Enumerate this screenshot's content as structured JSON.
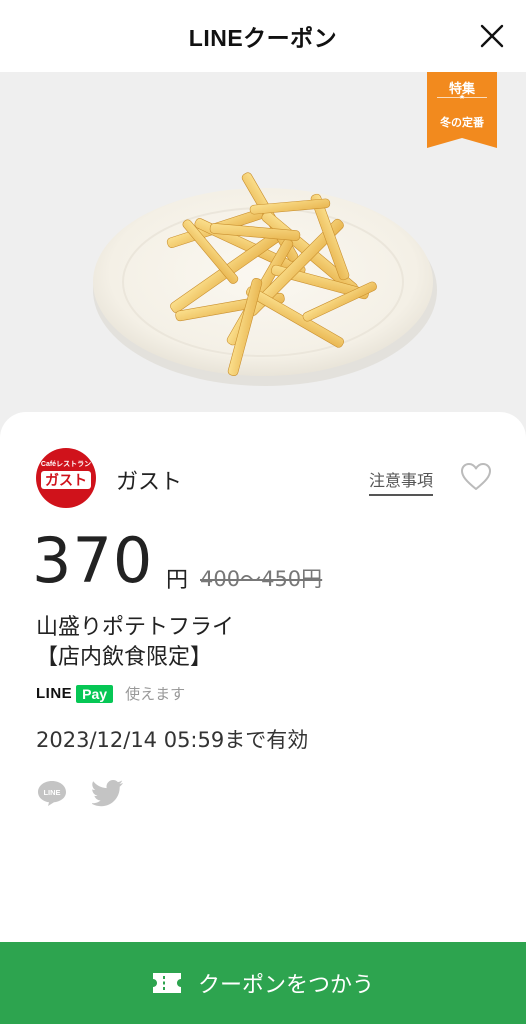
{
  "header": {
    "title": "LINEクーポン",
    "close_icon": "close-icon"
  },
  "hero": {
    "image": "french-fries-plate",
    "ribbon": {
      "line1": "特集",
      "line2": "冬の定番",
      "color": "#f28a1e"
    }
  },
  "coupon": {
    "brand": {
      "logo_text_top": "Caféレストラン",
      "logo_text_main": "ガスト",
      "logo_color": "#d0121b",
      "name": "ガスト"
    },
    "notes_link": "注意事項",
    "favorite_icon": "heart-icon",
    "price": "370",
    "price_unit": "円",
    "original_price": "400〜450円",
    "title_line1": "山盛りポテトフライ",
    "title_line2": "【店内飲食限定】",
    "linepay": {
      "line": "LINE",
      "pay": "Pay",
      "availability": "使えます",
      "color": "#06c755"
    },
    "validity": "2023/12/14  05:59まで有効",
    "share": {
      "line_icon": "line-share-icon",
      "line_icon_text": "LINE",
      "twitter_icon": "twitter-share-icon"
    }
  },
  "footer": {
    "button_label": "クーポンをつかう",
    "button_icon": "ticket-icon",
    "button_color": "#2da44f"
  }
}
